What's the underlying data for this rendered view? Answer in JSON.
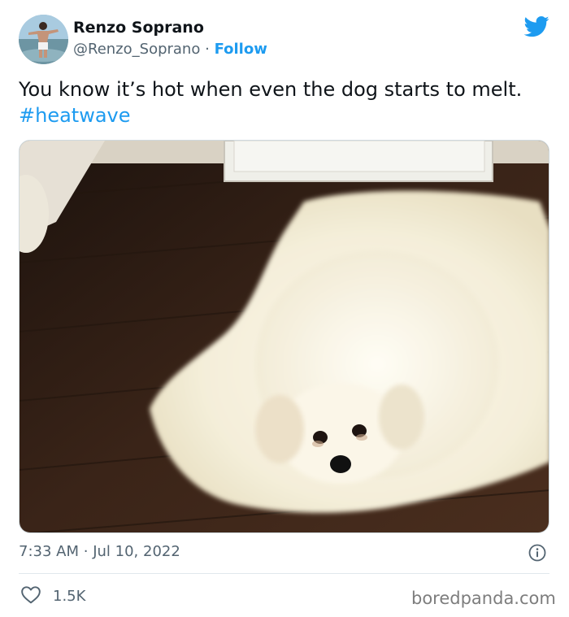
{
  "author": {
    "name": "Renzo Soprano",
    "handle": "@Renzo_Soprano",
    "separator": "·",
    "follow_label": "Follow"
  },
  "tweet": {
    "text": "You know it’s hot when even the dog starts to melt.",
    "hashtag": "#heatwave",
    "time": "7:33 AM",
    "date": "Jul 10, 2022",
    "likes": "1.5K"
  },
  "icons": {
    "brand": "twitter-bird-icon",
    "info": "info-icon",
    "like": "heart-icon"
  },
  "colors": {
    "accent": "#1d9bf0",
    "text": "#0f1419",
    "secondary": "#536471"
  },
  "watermark": "boredpanda.com"
}
